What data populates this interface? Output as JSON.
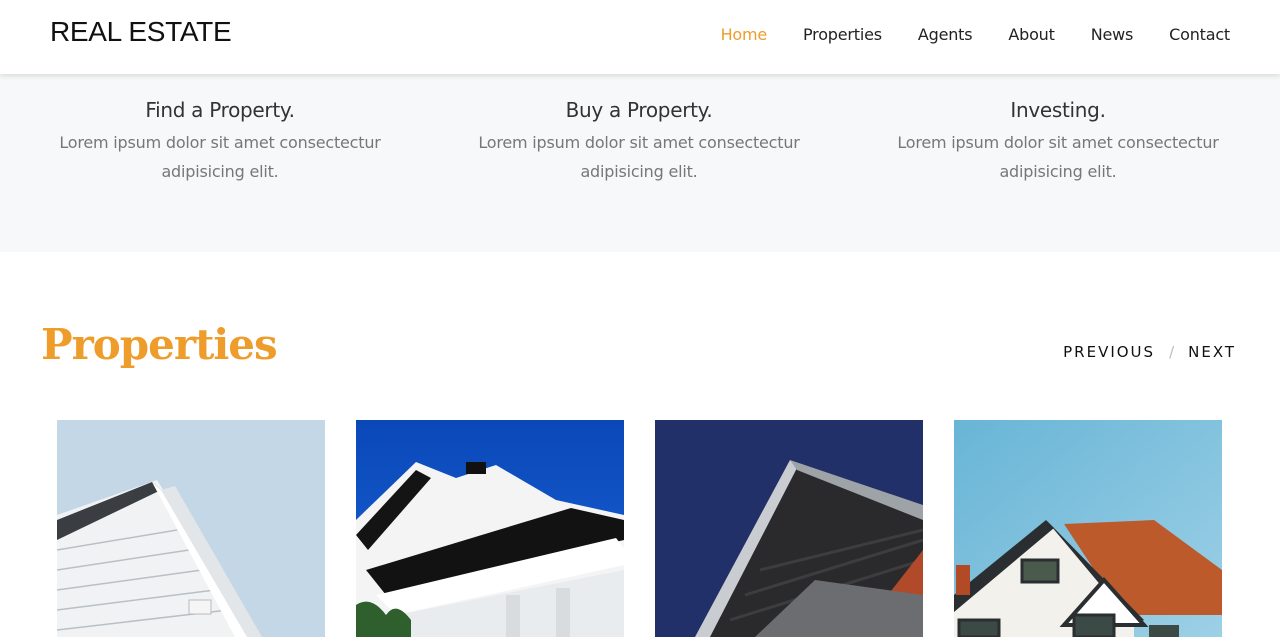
{
  "header": {
    "logo": "REAL ESTATE",
    "nav": [
      {
        "label": "Home",
        "active": true
      },
      {
        "label": "Properties",
        "active": false
      },
      {
        "label": "Agents",
        "active": false
      },
      {
        "label": "About",
        "active": false
      },
      {
        "label": "News",
        "active": false
      },
      {
        "label": "Contact",
        "active": false
      }
    ]
  },
  "features": [
    {
      "title": "Find a Property.",
      "text": "Lorem ipsum dolor sit amet consectectur adipisicing elit."
    },
    {
      "title": "Buy a Property.",
      "text": "Lorem ipsum dolor sit amet consectectur adipisicing elit."
    },
    {
      "title": "Investing.",
      "text": "Lorem ipsum dolor sit amet consectectur adipisicing elit."
    }
  ],
  "properties": {
    "title": "Properties",
    "previous": "PREVIOUS",
    "separator": "/",
    "next": "NEXT",
    "cards": [
      {
        "image": "white-house-gable-photo"
      },
      {
        "image": "modern-white-building-blue-sky-photo"
      },
      {
        "image": "dark-building-overhang-photo"
      },
      {
        "image": "tudor-house-red-roof-photo"
      }
    ]
  },
  "colors": {
    "accent": "#ee9d2b",
    "band": "#f7f8f9"
  }
}
